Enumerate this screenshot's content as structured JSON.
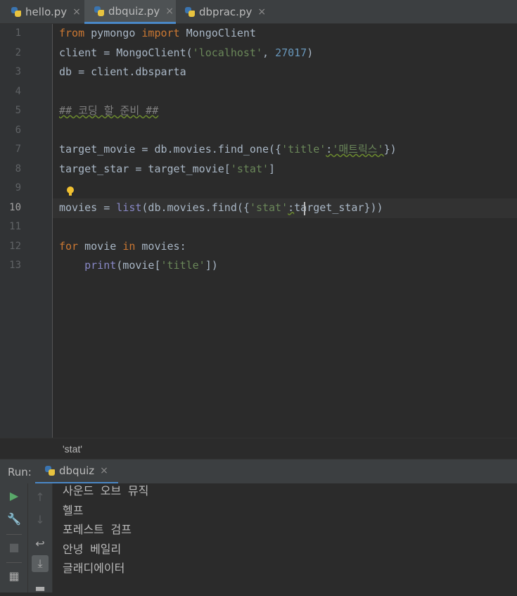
{
  "tabs": [
    {
      "label": "hello.py",
      "active": false
    },
    {
      "label": "dbquiz.py",
      "active": true
    },
    {
      "label": "dbprac.py",
      "active": false
    }
  ],
  "close_glyph": "×",
  "editor": {
    "current_line": 10,
    "line_numbers": [
      "1",
      "2",
      "3",
      "4",
      "5",
      "6",
      "7",
      "8",
      "9",
      "10",
      "11",
      "12",
      "13"
    ],
    "code": [
      [
        {
          "t": "from",
          "c": "kw"
        },
        {
          "t": " pymongo "
        },
        {
          "t": "import",
          "c": "kw"
        },
        {
          "t": " MongoClient"
        }
      ],
      [
        {
          "t": "client = MongoClient("
        },
        {
          "t": "'localhost'",
          "c": "str"
        },
        {
          "t": ", "
        },
        {
          "t": "27017",
          "c": "num"
        },
        {
          "t": ")"
        }
      ],
      [
        {
          "t": "db = client.dbsparta"
        }
      ],
      [],
      [
        {
          "t": "## 코딩 할 준비 ##",
          "c": "cm squig"
        }
      ],
      [],
      [
        {
          "t": "target_movie = db.movies.find_one({"
        },
        {
          "t": "'title'",
          "c": "str"
        },
        {
          "t": ":",
          "c": "squig"
        },
        {
          "t": "'매트릭스'",
          "c": "str squig"
        },
        {
          "t": "})"
        }
      ],
      [
        {
          "t": "target_star = target_movie["
        },
        {
          "t": "'stat'",
          "c": "str"
        },
        {
          "t": "]"
        }
      ],
      [],
      [
        {
          "t": "movies = "
        },
        {
          "t": "list",
          "c": "bi"
        },
        {
          "t": "(db.movies.find({"
        },
        {
          "t": "'stat'",
          "c": "str"
        },
        {
          "t": ":",
          "c": "squig"
        },
        {
          "t": "target_star}))"
        }
      ],
      [],
      [
        {
          "t": "for",
          "c": "kw"
        },
        {
          "t": " movie "
        },
        {
          "t": "in",
          "c": "kw"
        },
        {
          "t": " movies:"
        }
      ],
      [
        {
          "t": "    "
        },
        {
          "t": "print",
          "c": "bi"
        },
        {
          "t": "(movie["
        },
        {
          "t": "'title'",
          "c": "str"
        },
        {
          "t": "])"
        }
      ]
    ]
  },
  "breadcrumb": "'stat'",
  "run": {
    "label": "Run:",
    "tab_label": "dbquiz",
    "output": [
      "사운드 오브 뮤직",
      "헬프",
      "포레스트 검프",
      "안녕 베일리",
      "글래디에이터"
    ]
  },
  "colors": {
    "accent": "#4a88c7",
    "keyword": "#cc7832",
    "string": "#6a8759",
    "number": "#6897bb",
    "builtin": "#8888c6"
  }
}
